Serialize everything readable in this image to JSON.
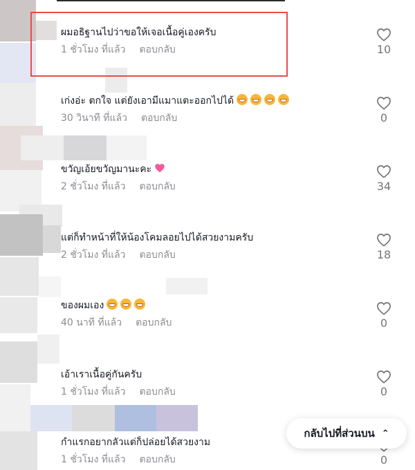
{
  "comments": [
    {
      "text": "ผมอธิฐานไปว่าขอให้เจอเนื้อคู่เองครับ",
      "time": "1 ชั่วโมง ที่แล้ว",
      "reply": "ตอบกลับ",
      "likes": "10",
      "emoji_count": 0
    },
    {
      "text": "เก่งอ่ะ ตกใจ แต่ยังเอามีแมาแตะออกไปได้",
      "time": "30 วินาที ที่แล้ว",
      "reply": "ตอบกลับ",
      "likes": "0",
      "emoji_count": 4
    },
    {
      "text": "ขวัญเอ้ยขวัญมานะคะ",
      "time": "2 ชั่วโมง ที่แล้ว",
      "reply": "ตอบกลับ",
      "likes": "34",
      "emoji_count": 1
    },
    {
      "text": "แต่ก็ทำหน้าที่ให้น้องโคมลอยไปได้สวยงามครับ",
      "time": "2 ชั่วโมง ที่แล้ว",
      "reply": "ตอบกลับ",
      "likes": "18",
      "emoji_count": 0
    },
    {
      "text": "ของผมเอง",
      "time": "40 นาที ที่แล้ว",
      "reply": "ตอบกลับ",
      "likes": "0",
      "emoji_count": 3
    },
    {
      "text": "เอ้าเราเนื้อคู่กันครับ",
      "time": "1 ชั่วโมง ที่แล้ว",
      "reply": "ตอบกลับ",
      "likes": "0",
      "emoji_count": 0
    },
    {
      "text": "กำแรกอยากลัวแต่ก็ปล่อยได้สวยงาม",
      "time": "1 ชั่วโมง ที่แล้ว",
      "reply": "ตอบกลับ",
      "likes": "0",
      "emoji_count": 0
    }
  ],
  "back_to_top": {
    "label": "กลับไปที่ส่วนบน"
  },
  "colors": {
    "highlight": "#e94b4b",
    "meta": "#8a8b91",
    "text": "#161823"
  },
  "icons": {
    "like": "heart-outline-icon",
    "emoji": "grinning-emoji",
    "heart_emoji": "pink-heart-emoji",
    "chevron": "double-chevron-up-icon"
  }
}
